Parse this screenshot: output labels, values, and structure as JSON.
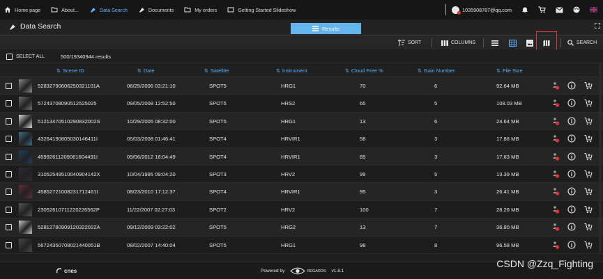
{
  "nav": {
    "home": "Home page",
    "about": "About...",
    "data_search": "Data Search",
    "documents": "Documents",
    "my_orders": "My orders",
    "slideshow": "Getting Started Slideshow",
    "user_email": "1035908787@qq.com"
  },
  "title": "Data Search",
  "results_tab": "Results",
  "toolbar": {
    "sort": "SORT",
    "columns": "COLUMNS",
    "search": "SEARCH"
  },
  "select_all": "SELECT ALL",
  "result_count": "500/19340944 results",
  "columns": {
    "scene_id": "Scene ID",
    "date": "Date",
    "satellite": "Satellite",
    "instrument": "Instrument",
    "cloud_free": "Cloud Free %",
    "gain_number": "Gain Number",
    "file_size": "File Size"
  },
  "rows": [
    {
      "scene_id": "52832790606250321101A",
      "date": "06/25/2006 03:21:10",
      "satellite": "SPOT5",
      "instrument": "HRG1",
      "cloud_free": "70",
      "gain": "6",
      "size": "92.64 MB",
      "thumb": "#8a8a8a"
    },
    {
      "scene_id": "57243708090512525025",
      "date": "09/05/2008 12:52:50",
      "satellite": "SPOT5",
      "instrument": "HRS2",
      "cloud_free": "65",
      "gain": "5",
      "size": "108.03 MB",
      "thumb": "#6d6d6d"
    },
    {
      "scene_id": "51213470510290832002S",
      "date": "10/29/2005 08:32:00",
      "satellite": "SPOT5",
      "instrument": "HRG1",
      "cloud_free": "13",
      "gain": "6",
      "size": "24.64 MB",
      "thumb": "#d9d9d9"
    },
    {
      "scene_id": "43264190805030146411I",
      "date": "05/03/2008 01:46:41",
      "satellite": "SPOT4",
      "instrument": "HRVIR1",
      "cloud_free": "58",
      "gain": "3",
      "size": "17.86 MB",
      "thumb": "#3b6d8c"
    },
    {
      "scene_id": "45992611209061604491I",
      "date": "09/06/2012 16:04:49",
      "satellite": "SPOT4",
      "instrument": "HRVIR1",
      "cloud_free": "85",
      "gain": "3",
      "size": "17.63 MB",
      "thumb": "#1d3f66"
    },
    {
      "scene_id": "31052549510040904142X",
      "date": "10/04/1995 09:04:20",
      "satellite": "SPOT3",
      "instrument": "HRV2",
      "cloud_free": "99",
      "gain": "5",
      "size": "13.39 MB",
      "thumb": "#2c2c3c"
    },
    {
      "scene_id": "45852721008231712461I",
      "date": "08/23/2010 17:12:37",
      "satellite": "SPOT4",
      "instrument": "HRVIR1",
      "cloud_free": "95",
      "gain": "3",
      "size": "26.41 MB",
      "thumb": "#6b2a36"
    },
    {
      "scene_id": "23052610711220226562P",
      "date": "11/22/2007 02:27:03",
      "satellite": "SPOT2",
      "instrument": "HRV2",
      "cloud_free": "100",
      "gain": "7",
      "size": "28.26 MB",
      "thumb": "#555555"
    },
    {
      "scene_id": "52812780909120322022A",
      "date": "09/12/2009 03:22:02",
      "satellite": "SPOT5",
      "instrument": "HRG2",
      "cloud_free": "13",
      "gain": "7",
      "size": "36.80 MB",
      "thumb": "#c9c9c9"
    },
    {
      "scene_id": "56724350708021440051B",
      "date": "08/02/2007 14:40:04",
      "satellite": "SPOT5",
      "instrument": "HRG1",
      "cloud_free": "98",
      "gain": "8",
      "size": "96.58 MB",
      "thumb": "#4a4a4a"
    }
  ],
  "footer": {
    "cnes": "cnes",
    "powered_by": "Powered by",
    "regards": "REGARDS",
    "version": "v1.8.1"
  },
  "watermark": "CSDN @Zzq_Fighting",
  "colors": {
    "accent": "#5ab4ff",
    "tab": "#64b5ee",
    "highlight": "#e23a3a",
    "badge": "#e0362d"
  }
}
